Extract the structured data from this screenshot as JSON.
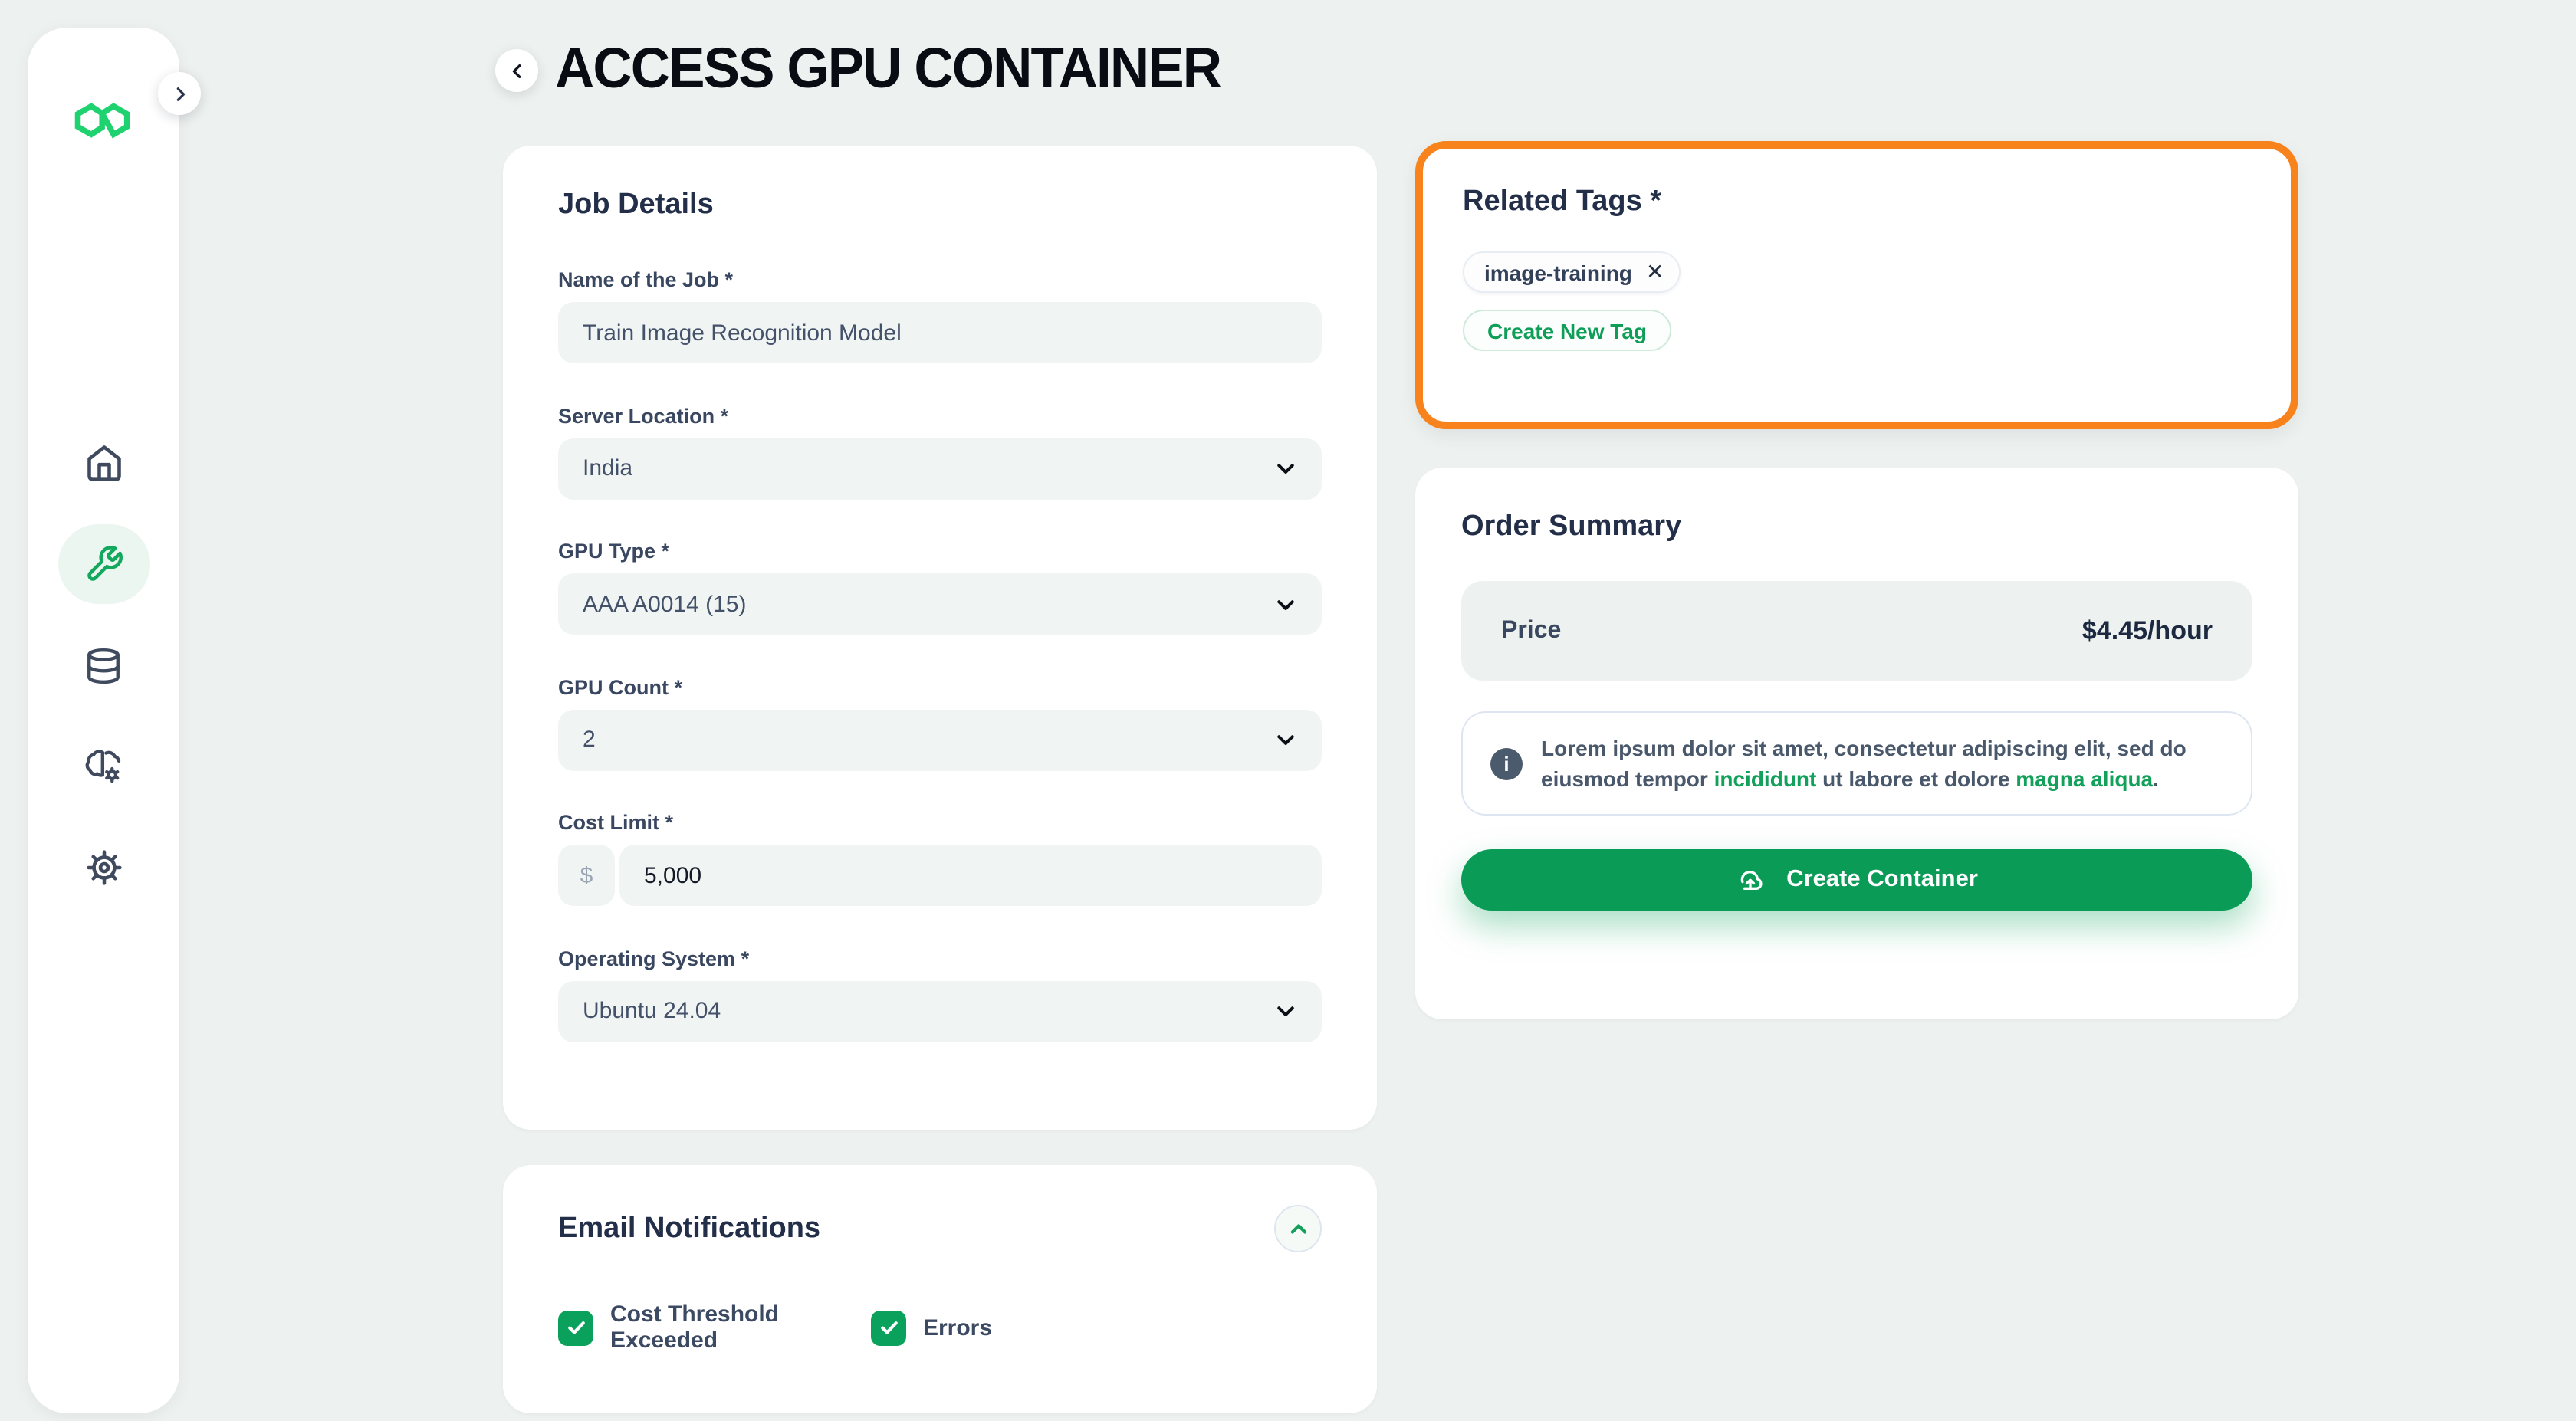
{
  "header": {
    "title": "ACCESS GPU CONTAINER"
  },
  "sidebar": {
    "items": [
      {
        "id": "home",
        "icon": "home-icon",
        "active": false
      },
      {
        "id": "tools",
        "icon": "wrench-icon",
        "active": true
      },
      {
        "id": "database",
        "icon": "database-icon",
        "active": false
      },
      {
        "id": "ai",
        "icon": "brain-gear-icon",
        "active": false
      },
      {
        "id": "settings",
        "icon": "gear-icon",
        "active": false
      }
    ]
  },
  "job_details": {
    "title": "Job Details",
    "fields": [
      {
        "label": "Name of the Job *",
        "value": "Train Image Recognition Model"
      },
      {
        "label": "Server Location *",
        "value": "India"
      },
      {
        "label": "GPU Type *",
        "value": "AAA A0014 (15)"
      },
      {
        "label": "GPU Count *",
        "value": "2"
      },
      {
        "label": "Cost Limit *",
        "prefix": "$",
        "value": "5,000"
      },
      {
        "label": "Operating System *",
        "value": "Ubuntu 24.04"
      }
    ]
  },
  "email_notifications": {
    "title": "Email Notifications",
    "options": [
      {
        "label": "Cost Threshold Exceeded",
        "checked": true
      },
      {
        "label": "Errors",
        "checked": true
      }
    ]
  },
  "related_tags": {
    "title": "Related Tags *",
    "tags": [
      {
        "label": "image-training",
        "remove_glyph": "✕"
      }
    ],
    "create_label": "Create New Tag"
  },
  "order_summary": {
    "title": "Order Summary",
    "price_label": "Price",
    "price_value": "$4.45/hour",
    "info_segments": [
      {
        "t": "Lorem ipsum dolor sit amet, consectetur adipiscing elit, sed do eiusmod tempor "
      },
      {
        "t": "incididunt",
        "green": true
      },
      {
        "t": " ut labore et dolore "
      },
      {
        "t": "magna aliqua",
        "green": true
      },
      {
        "t": "."
      }
    ],
    "cta_label": "Create Container"
  },
  "colors": {
    "accent_green": "#0f9e58",
    "logo_green": "#1ed36f",
    "highlight_orange": "#f8821c",
    "page_bg": "#edf1ef"
  }
}
